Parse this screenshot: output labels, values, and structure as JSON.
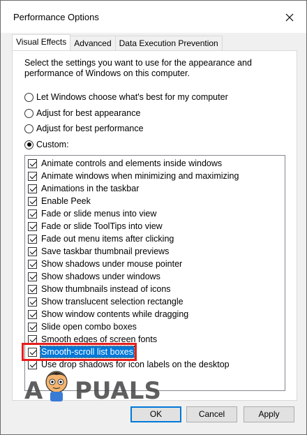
{
  "window": {
    "title": "Performance Options"
  },
  "tabs": [
    {
      "label": "Visual Effects",
      "active": true
    },
    {
      "label": "Advanced",
      "active": false
    },
    {
      "label": "Data Execution Prevention",
      "active": false
    }
  ],
  "description": "Select the settings you want to use for the appearance and performance of Windows on this computer.",
  "radios": [
    {
      "label": "Let Windows choose what's best for my computer",
      "checked": false
    },
    {
      "label": "Adjust for best appearance",
      "checked": false
    },
    {
      "label": "Adjust for best performance",
      "checked": false
    },
    {
      "label": "Custom:",
      "checked": true
    }
  ],
  "effects": [
    {
      "label": "Animate controls and elements inside windows",
      "checked": true
    },
    {
      "label": "Animate windows when minimizing and maximizing",
      "checked": true
    },
    {
      "label": "Animations in the taskbar",
      "checked": true
    },
    {
      "label": "Enable Peek",
      "checked": true
    },
    {
      "label": "Fade or slide menus into view",
      "checked": true
    },
    {
      "label": "Fade or slide ToolTips into view",
      "checked": true
    },
    {
      "label": "Fade out menu items after clicking",
      "checked": true
    },
    {
      "label": "Save taskbar thumbnail previews",
      "checked": true
    },
    {
      "label": "Show shadows under mouse pointer",
      "checked": true
    },
    {
      "label": "Show shadows under windows",
      "checked": true
    },
    {
      "label": "Show thumbnails instead of icons",
      "checked": true
    },
    {
      "label": "Show translucent selection rectangle",
      "checked": true
    },
    {
      "label": "Show window contents while dragging",
      "checked": true
    },
    {
      "label": "Slide open combo boxes",
      "checked": true
    },
    {
      "label": "Smooth edges of screen fonts",
      "checked": true
    },
    {
      "label": "Smooth-scroll list boxes",
      "checked": true,
      "selected": true
    },
    {
      "label": "Use drop shadows for icon labels on the desktop",
      "checked": true
    }
  ],
  "buttons": {
    "ok": "OK",
    "cancel": "Cancel",
    "apply": "Apply"
  },
  "watermark": {
    "text": "APPUALS"
  },
  "colors": {
    "highlight_border": "#e61e1e",
    "selection": "#0078d7"
  }
}
